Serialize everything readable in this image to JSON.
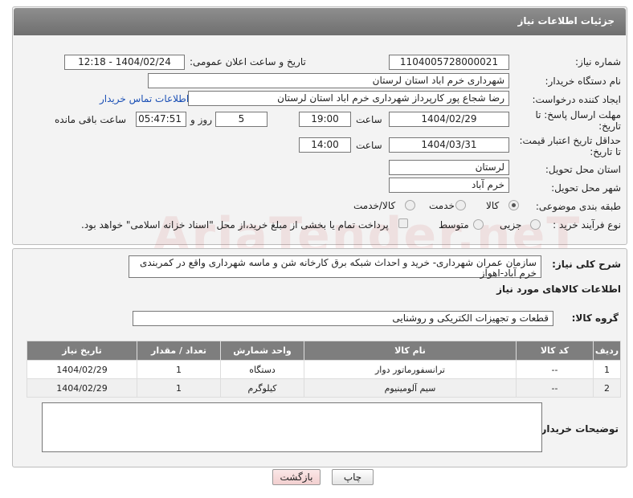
{
  "header": {
    "title": "جزئیات اطلاعات نیاز"
  },
  "fields": {
    "need_number_label": "شماره نیاز:",
    "need_number": "1104005728000021",
    "announce_label": "تاریخ و ساعت اعلان عمومی:",
    "announce_value": "1404/02/24 - 12:18",
    "buyer_org_label": "نام دستگاه خریدار:",
    "buyer_org": "شهرداری خرم اباد استان لرستان",
    "creator_label": "ایجاد کننده درخواست:",
    "creator": "رضا شجاع پور کارپرداز شهرداری خرم اباد استان لرستان",
    "buyer_contact_link": "اطلاعات تماس خریدار",
    "reply_deadline_label_1": "مهلت ارسال پاسخ: تا",
    "reply_deadline_label_2": "تاریخ:",
    "reply_date": "1404/02/29",
    "time_label": "ساعت",
    "reply_time": "19:00",
    "days": "5",
    "days_label": "روز و",
    "remaining": "05:47:51",
    "remaining_label": "ساعت باقی مانده",
    "price_deadline_label_1": "حداقل تاریخ اعتبار قیمت:",
    "price_deadline_label_2": "تا تاریخ:",
    "price_date": "1404/03/31",
    "price_time": "14:00",
    "province_label": "استان محل تحویل:",
    "province": "لرستان",
    "city_label": "شهر محل تحویل:",
    "city": "خرم آباد",
    "category_label": "طبقه بندی موضوعی:",
    "category_options": [
      "کالا",
      "خدمت",
      "کالا/خدمت"
    ],
    "process_label": "نوع فرآیند خرید :",
    "process_options": [
      "جزیی",
      "متوسط"
    ],
    "payment_note": "پرداخت تمام یا بخشی از مبلغ خرید،از محل \"اسناد خزانه اسلامی\" خواهد بود."
  },
  "description": {
    "label": "شرح کلی نیاز:",
    "text": "سازمان عمران شهرداری- خرید و احداث شبکه برق کارخانه شن و ماسه شهرداری واقع در کمربندی خرم آباد-اهواز"
  },
  "goods": {
    "section_title": "اطلاعات کالاهای مورد نیاز",
    "group_label": "گروه کالا:",
    "group": "قطعات و تجهیزات الکتریکی و روشنایی",
    "columns": [
      "ردیف",
      "کد کالا",
      "نام کالا",
      "واحد شمارش",
      "تعداد / مقدار",
      "تاریخ نیاز"
    ],
    "rows": [
      [
        "1",
        "--",
        "ترانسفورماتور دوار",
        "دستگاه",
        "1",
        "1404/02/29"
      ],
      [
        "2",
        "--",
        "سیم آلومینیوم",
        "کیلوگرم",
        "1",
        "1404/02/29"
      ]
    ]
  },
  "buyer_notes": {
    "label": "توضیحات خریدار:",
    "text": ""
  },
  "buttons": {
    "print": "چاپ",
    "back": "بازگشت"
  },
  "watermark": "AriaTender.neT",
  "colors": {
    "titlebar": "#7e7e7e",
    "link": "#1a4fb5",
    "back_button": "#f7dcdc"
  }
}
